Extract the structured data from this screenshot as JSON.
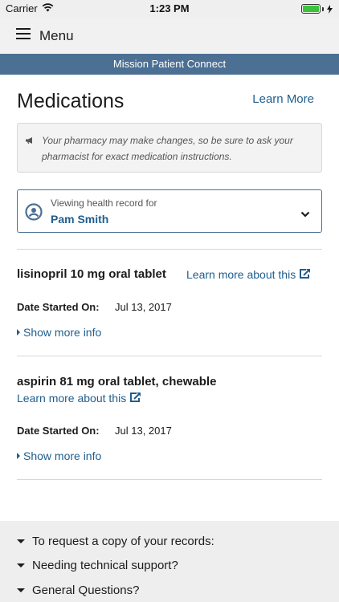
{
  "status_bar": {
    "carrier": "Carrier",
    "time": "1:23 PM",
    "battery_level": 1.0,
    "battery_color": "#3dc23d"
  },
  "nav": {
    "menu_label": "Menu",
    "menu_icon": "hamburger-icon"
  },
  "banner": {
    "title": "Mission Patient Connect",
    "color": "#4c7094"
  },
  "page": {
    "title": "Medications",
    "learn_more": "Learn More"
  },
  "notice": {
    "icon": "megaphone-icon",
    "text": "Your pharmacy may make changes, so be sure to ask your pharmacist for exact medication instructions."
  },
  "record_selector": {
    "caption": "Viewing health record for",
    "patient_name": "Pam Smith",
    "icon": "person-circle-icon",
    "dropdown_icon": "chevron-down-icon"
  },
  "medications": [
    {
      "name": "lisinopril 10 mg oral tablet",
      "learn_more": "Learn more about this",
      "date_label": "Date Started On:",
      "date_value": "Jul 13, 2017",
      "show_more": "Show more info"
    },
    {
      "name": "aspirin 81 mg oral tablet, chewable",
      "learn_more": "Learn more about this",
      "date_label": "Date Started On:",
      "date_value": "Jul 13, 2017",
      "show_more": "Show more info"
    }
  ],
  "footer": {
    "items": [
      {
        "label": "To request a copy of your records:"
      },
      {
        "label": "Needing technical support?"
      },
      {
        "label": "General Questions?"
      }
    ]
  },
  "colors": {
    "link": "#1f5e8e",
    "accent": "#4c7094"
  }
}
